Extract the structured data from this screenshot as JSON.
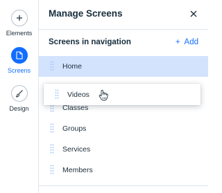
{
  "rail": {
    "items": [
      {
        "label": "Elements",
        "icon": "plus-icon",
        "active": false
      },
      {
        "label": "Screens",
        "icon": "page-icon",
        "active": true
      },
      {
        "label": "Design",
        "icon": "brush-icon",
        "active": false
      }
    ]
  },
  "panel": {
    "title": "Manage Screens",
    "section_title": "Screens in navigation",
    "add_label": "Add",
    "screens": [
      {
        "label": "Home",
        "selected": true
      },
      {
        "label": "Classes",
        "selected": false
      },
      {
        "label": "Groups",
        "selected": false
      },
      {
        "label": "Services",
        "selected": false
      },
      {
        "label": "Members",
        "selected": false
      }
    ],
    "dragging_item": "Videos"
  },
  "colors": {
    "accent": "#116dff",
    "selected_row": "#d3e2fd",
    "text": "#20303c",
    "divider": "#dfe5eb"
  }
}
